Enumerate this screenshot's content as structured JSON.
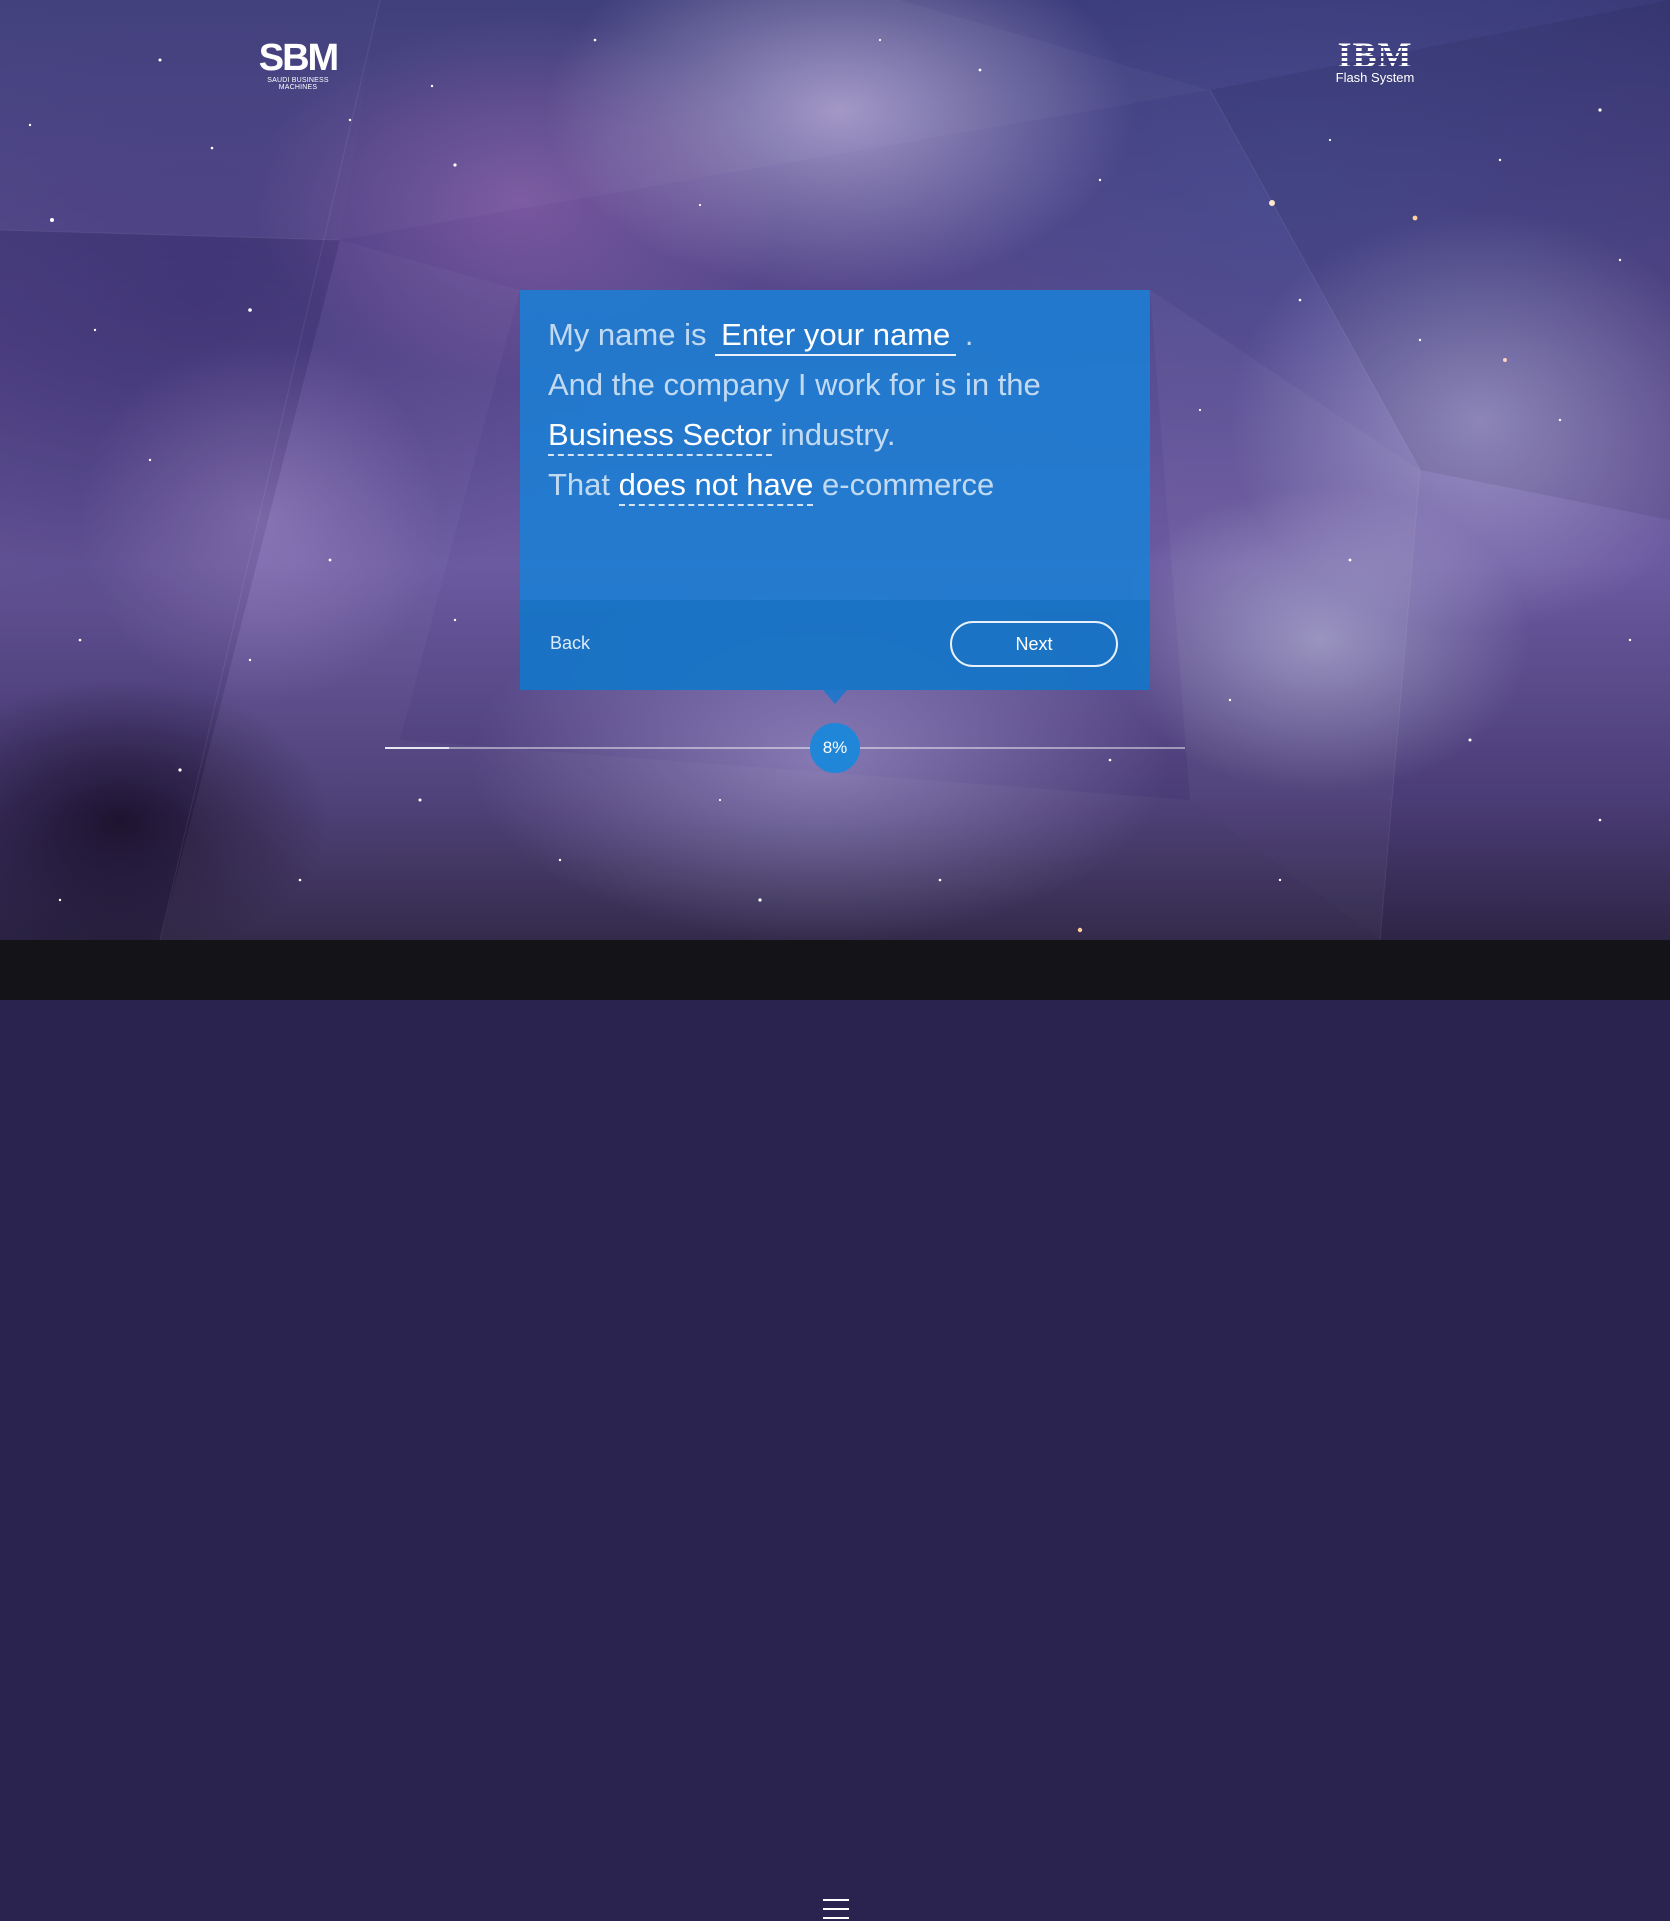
{
  "brand": {
    "left_logo": "SBM",
    "left_logo_subtitle": "SAUDI BUSINESS MACHINES",
    "right_logo": "IBM",
    "right_logo_subtitle": "Flash System"
  },
  "form": {
    "line1_prefix": "My name is",
    "name_placeholder": "Enter your name",
    "line1_suffix": ".",
    "line2": "And the company I work for is in the",
    "sector_value": "Business Sector",
    "line3_suffix": "industry.",
    "line4_prefix": "That",
    "ecommerce_value": "does not have",
    "line4_suffix": "e-commerce"
  },
  "nav": {
    "back_label": "Back",
    "next_label": "Next"
  },
  "progress": {
    "label": "8%",
    "value": 0.08
  },
  "icons": {
    "menu": "hamburger-menu-icon"
  },
  "colors": {
    "card": "#1a80d6",
    "progress_knob": "#1f86d8",
    "bottom_bar": "#141318"
  }
}
